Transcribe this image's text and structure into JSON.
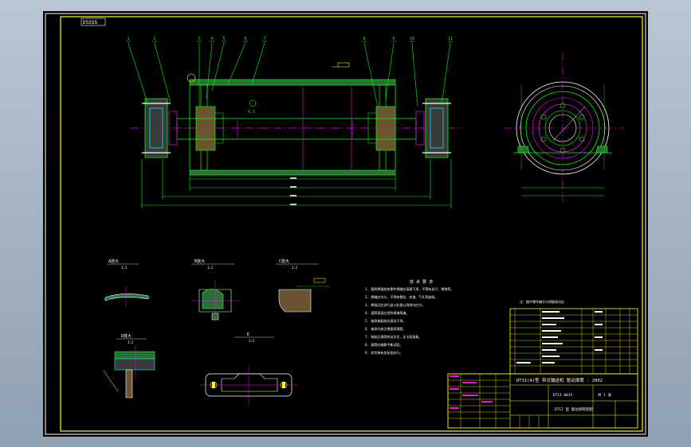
{
  "drawing": {
    "tag": "DSSSS",
    "balloons": [
      "1",
      "2",
      "3",
      "4",
      "5",
      "6",
      "7",
      "8",
      "9",
      "10",
      "11"
    ],
    "roughness_symbol": "6.3",
    "details": {
      "a": {
        "title": "A放大",
        "scale": "1:2"
      },
      "b": {
        "title": "B放大",
        "scale": "1:2"
      },
      "c": {
        "title": "C放大",
        "scale": "1:2"
      },
      "d": {
        "title": "D放大",
        "scale": "1:2"
      },
      "e": {
        "title": "E",
        "scale": "1:2"
      }
    },
    "notes_title": "技 术 要 求",
    "notes": [
      "1. 滚筒焊接前各零件焊缝应清理干净，不得有油污、锈蚀等。",
      "2. 焊缝应均匀，不得有裂纹、夹渣、气孔等缺陷。",
      "3. 焊接后应进行退火处理以消除内应力。",
      "4. 滚筒表面应涂防锈漆两遍。",
      "5. 轴承装配前应清洗干净。",
      "6. 轴承内加注锂基润滑脂。",
      "7. 装配后滚筒转动灵活，无卡阻现象。",
      "8. 滚筒应做静平衡试验。",
      "9. 其余按有关标准执行。"
    ],
    "parts_header": "注：图中零件编号与明细表对应",
    "title_block": {
      "project": "DTII(A)型 带式输送机 驱动滚筒 - 2002",
      "drawing_no": "DTII 0015",
      "name": "DTII 型 驱动滚筒装配",
      "sheet": "共 1 张"
    }
  }
}
